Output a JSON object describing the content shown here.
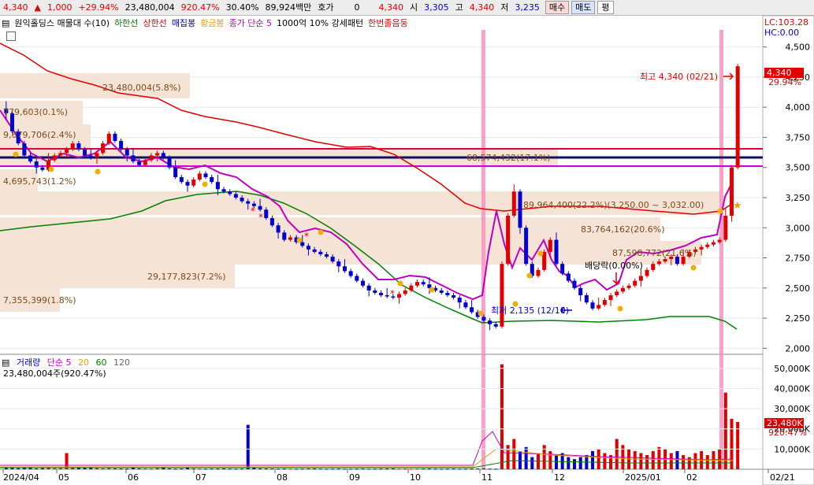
{
  "header": {
    "price": "4,340",
    "change": "1,000",
    "change_pct": "+29.94%",
    "volume": "23,480,004",
    "volume_ratio": "920.47%",
    "turnover_pct": "30.40%",
    "amount": "89,924백만",
    "quote_label": "호가",
    "quote_value": "0",
    "quote_price": "4,340",
    "open_label": "시",
    "open": "3,305",
    "high_label": "고",
    "high": "4,340",
    "low_label": "저",
    "low": "3,235",
    "buy_label": "매수",
    "sell_label": "매도",
    "flat_label": "평"
  },
  "legend": {
    "title": "원익홀딩스 매물대 수(10)",
    "items": [
      {
        "label": "하한선",
        "color": "#008000"
      },
      {
        "label": "상한선",
        "color": "#e00000"
      },
      {
        "label": "매집봉",
        "color": "#0000d0"
      },
      {
        "label": "황금봉",
        "color": "#e8a000"
      },
      {
        "label": "종가 단순 5",
        "color": "#c000c0"
      },
      {
        "label": "1000억 10% 강세패턴",
        "color": "#000000"
      },
      {
        "label": "한번졸음둥",
        "color": "#e00000"
      }
    ]
  },
  "right_axis": {
    "lc": "LC:103.28",
    "hc": "HC:0.00",
    "price_ticks": [
      "4,500",
      "4,250",
      "4,000",
      "3,750",
      "3,500",
      "3,250",
      "3,000",
      "2,750",
      "2,500",
      "2,250",
      "2,000"
    ],
    "volume_ticks": [
      "50,000K",
      "40,000K",
      "30,000K",
      "20,000K",
      "10,000K"
    ],
    "current_price_label": "4,340",
    "current_pct_label": "29.94%",
    "current_volume_label": "23,480K",
    "current_volume_pct": "920.47%"
  },
  "x_axis": {
    "labels": [
      "2024/04",
      "05",
      "06",
      "07",
      "08",
      "09",
      "10",
      "11",
      "12",
      "2025/01",
      "02",
      "02/21"
    ]
  },
  "annotations": {
    "peak_high": "최고 4,340 (02/21)",
    "low_point": "최저 2,135 (12/10)",
    "dividend": "배당락(0.00%)",
    "zone_1": "23,480,004(5.8%)",
    "zone_2": "779,603(0.1%)",
    "zone_3": "9,679,706(2.4%)",
    "zone_4": "4,695,743(1.2%)",
    "zone_5": "29,177,823(7.2%)",
    "zone_6": "7,355,399(1.8%)",
    "zone_7": "68,574,432(17.1%)",
    "zone_8": "89,964,400(22.2%)(3,250.00 ~ 3,032.00)",
    "zone_9": "83,764,162(20.6%)",
    "zone_10": "87,598,772(21.6%)"
  },
  "volume_legend": {
    "title": "거래량",
    "ma_label": "단순 5",
    "ma20": "20",
    "ma60": "60",
    "ma120": "120",
    "current": "23,480,004주(920.47%)"
  },
  "chart_data": {
    "type": "candlestick",
    "price_range": [
      1950,
      4550
    ],
    "volume_range": [
      0,
      55000
    ],
    "closes": [
      3950,
      3800,
      3700,
      3600,
      3550,
      3500,
      3480,
      3560,
      3600,
      3620,
      3650,
      3700,
      3650,
      3600,
      3580,
      3620,
      3700,
      3780,
      3720,
      3650,
      3600,
      3550,
      3520,
      3560,
      3600,
      3620,
      3580,
      3500,
      3420,
      3380,
      3350,
      3400,
      3450,
      3420,
      3380,
      3320,
      3300,
      3280,
      3250,
      3220,
      3200,
      3180,
      3150,
      3080,
      3020,
      2960,
      2900,
      2920,
      2880,
      2850,
      2820,
      2800,
      2780,
      2760,
      2720,
      2680,
      2640,
      2600,
      2560,
      2520,
      2480,
      2460,
      2440,
      2430,
      2420,
      2450,
      2480,
      2520,
      2550,
      2530,
      2500,
      2480,
      2460,
      2440,
      2420,
      2380,
      2340,
      2300,
      2260,
      2230,
      2200,
      2180,
      2700,
      3100,
      3300,
      3000,
      2700,
      2600,
      2650,
      2800,
      2900,
      2700,
      2620,
      2560,
      2500,
      2440,
      2380,
      2330,
      2360,
      2400,
      2440,
      2470,
      2500,
      2520,
      2560,
      2600,
      2650,
      2700,
      2720,
      2740,
      2760,
      2700,
      2760,
      2800,
      2820,
      2840,
      2860,
      2880,
      2900,
      3100,
      3500,
      4340
    ],
    "volumes": [
      800,
      600,
      500,
      900,
      700,
      400,
      500,
      600,
      450,
      500,
      8000,
      1200,
      900,
      700,
      600,
      500,
      400,
      500,
      400,
      350,
      300,
      600,
      400,
      350,
      300,
      500,
      700,
      400,
      300,
      350,
      600,
      400,
      300,
      250,
      300,
      350,
      400,
      300,
      250,
      300,
      22000,
      600,
      400,
      350,
      300,
      250,
      300,
      250,
      200,
      250,
      300,
      350,
      250,
      200,
      250,
      300,
      200,
      200,
      250,
      300,
      200,
      250,
      300,
      350,
      400,
      250,
      300,
      200,
      250,
      300,
      350,
      250,
      200,
      250,
      300,
      200,
      250,
      300,
      350,
      400,
      300,
      250,
      52000,
      12000,
      15000,
      9000,
      11000,
      6000,
      8000,
      12000,
      9000,
      7000,
      8000,
      6000,
      5000,
      6000,
      7000,
      9000,
      10000,
      8000,
      7000,
      15000,
      12000,
      10000,
      9000,
      8000,
      7000,
      9000,
      11000,
      10000,
      8000,
      9000,
      7000,
      6000,
      8000,
      9000,
      7000,
      9000,
      10000,
      38000,
      25000,
      23480
    ],
    "upper_band": "red line",
    "lower_band": "green line",
    "ma5": "magenta line"
  }
}
